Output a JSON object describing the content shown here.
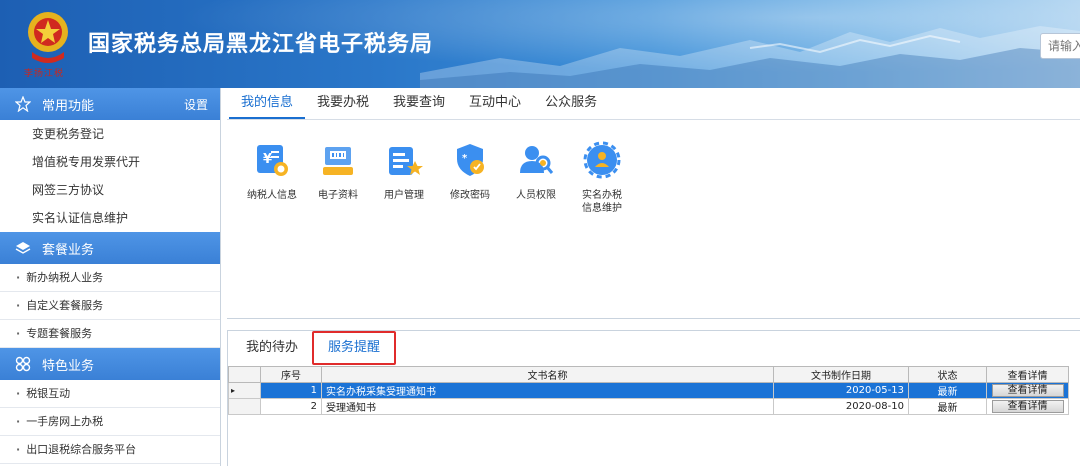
{
  "header": {
    "title": "国家税务总局黑龙江省电子税务局",
    "sign": "李扬江税",
    "search_placeholder": "请输入"
  },
  "sidebar": {
    "sections": [
      {
        "title": "常用功能",
        "icon": "star-icon",
        "setting": "设置",
        "items": [
          "变更税务登记",
          "增值税专用发票代开",
          "网签三方协议",
          "实名认证信息维护"
        ]
      },
      {
        "title": "套餐业务",
        "icon": "layers-icon",
        "items": [
          "新办纳税人业务",
          "自定义套餐服务",
          "专题套餐服务"
        ]
      },
      {
        "title": "特色业务",
        "icon": "grid-icon",
        "items": [
          "税银互动",
          "一手房网上办税",
          "出口退税综合服务平台"
        ]
      }
    ]
  },
  "top_tabs": [
    "我的信息",
    "我要办税",
    "我要查询",
    "互动中心",
    "公众服务"
  ],
  "functions": [
    {
      "label": "纳税人信息",
      "icon": "taxpayer-info-icon"
    },
    {
      "label": "电子资料",
      "icon": "electronic-data-icon"
    },
    {
      "label": "用户管理",
      "icon": "user-management-icon"
    },
    {
      "label": "修改密码",
      "icon": "change-password-icon"
    },
    {
      "label": "人员权限",
      "icon": "personnel-permission-icon"
    },
    {
      "label": "实名办税信息维护",
      "label_lines": [
        "实名办税",
        "信息维护"
      ],
      "icon": "realname-maintenance-icon"
    }
  ],
  "sub_tabs": [
    "我的待办",
    "服务提醒"
  ],
  "table": {
    "columns": [
      "序号",
      "文书名称",
      "文书制作日期",
      "状态",
      "查看详情"
    ],
    "rows": [
      {
        "no": "1",
        "name": "实名办税采集受理通知书",
        "date": "2020-05-13",
        "status": "最新",
        "action": "查看详情"
      },
      {
        "no": "2",
        "name": "受理通知书",
        "date": "2020-08-10",
        "status": "最新",
        "action": "查看详情"
      }
    ]
  },
  "colors": {
    "accent": "#1a6fd0",
    "sidebar_header": "#3a80d6",
    "highlight_border": "#e02b2b",
    "selected_row": "#1b73d6"
  }
}
